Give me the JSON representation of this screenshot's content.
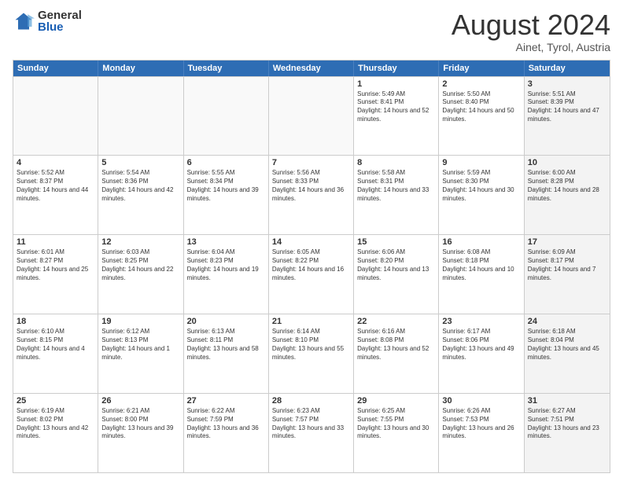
{
  "logo": {
    "general": "General",
    "blue": "Blue"
  },
  "title": "August 2024",
  "location": "Ainet, Tyrol, Austria",
  "days": [
    "Sunday",
    "Monday",
    "Tuesday",
    "Wednesday",
    "Thursday",
    "Friday",
    "Saturday"
  ],
  "weeks": [
    [
      {
        "day": "",
        "empty": true
      },
      {
        "day": "",
        "empty": true
      },
      {
        "day": "",
        "empty": true
      },
      {
        "day": "",
        "empty": true
      },
      {
        "day": "1",
        "sunrise": "5:49 AM",
        "sunset": "8:41 PM",
        "daylight": "14 hours and 52 minutes."
      },
      {
        "day": "2",
        "sunrise": "5:50 AM",
        "sunset": "8:40 PM",
        "daylight": "14 hours and 50 minutes."
      },
      {
        "day": "3",
        "sunrise": "5:51 AM",
        "sunset": "8:39 PM",
        "daylight": "14 hours and 47 minutes.",
        "shaded": true
      }
    ],
    [
      {
        "day": "4",
        "sunrise": "5:52 AM",
        "sunset": "8:37 PM",
        "daylight": "14 hours and 44 minutes."
      },
      {
        "day": "5",
        "sunrise": "5:54 AM",
        "sunset": "8:36 PM",
        "daylight": "14 hours and 42 minutes."
      },
      {
        "day": "6",
        "sunrise": "5:55 AM",
        "sunset": "8:34 PM",
        "daylight": "14 hours and 39 minutes."
      },
      {
        "day": "7",
        "sunrise": "5:56 AM",
        "sunset": "8:33 PM",
        "daylight": "14 hours and 36 minutes."
      },
      {
        "day": "8",
        "sunrise": "5:58 AM",
        "sunset": "8:31 PM",
        "daylight": "14 hours and 33 minutes."
      },
      {
        "day": "9",
        "sunrise": "5:59 AM",
        "sunset": "8:30 PM",
        "daylight": "14 hours and 30 minutes."
      },
      {
        "day": "10",
        "sunrise": "6:00 AM",
        "sunset": "8:28 PM",
        "daylight": "14 hours and 28 minutes.",
        "shaded": true
      }
    ],
    [
      {
        "day": "11",
        "sunrise": "6:01 AM",
        "sunset": "8:27 PM",
        "daylight": "14 hours and 25 minutes."
      },
      {
        "day": "12",
        "sunrise": "6:03 AM",
        "sunset": "8:25 PM",
        "daylight": "14 hours and 22 minutes."
      },
      {
        "day": "13",
        "sunrise": "6:04 AM",
        "sunset": "8:23 PM",
        "daylight": "14 hours and 19 minutes."
      },
      {
        "day": "14",
        "sunrise": "6:05 AM",
        "sunset": "8:22 PM",
        "daylight": "14 hours and 16 minutes."
      },
      {
        "day": "15",
        "sunrise": "6:06 AM",
        "sunset": "8:20 PM",
        "daylight": "14 hours and 13 minutes."
      },
      {
        "day": "16",
        "sunrise": "6:08 AM",
        "sunset": "8:18 PM",
        "daylight": "14 hours and 10 minutes."
      },
      {
        "day": "17",
        "sunrise": "6:09 AM",
        "sunset": "8:17 PM",
        "daylight": "14 hours and 7 minutes.",
        "shaded": true
      }
    ],
    [
      {
        "day": "18",
        "sunrise": "6:10 AM",
        "sunset": "8:15 PM",
        "daylight": "14 hours and 4 minutes."
      },
      {
        "day": "19",
        "sunrise": "6:12 AM",
        "sunset": "8:13 PM",
        "daylight": "14 hours and 1 minute."
      },
      {
        "day": "20",
        "sunrise": "6:13 AM",
        "sunset": "8:11 PM",
        "daylight": "13 hours and 58 minutes."
      },
      {
        "day": "21",
        "sunrise": "6:14 AM",
        "sunset": "8:10 PM",
        "daylight": "13 hours and 55 minutes."
      },
      {
        "day": "22",
        "sunrise": "6:16 AM",
        "sunset": "8:08 PM",
        "daylight": "13 hours and 52 minutes."
      },
      {
        "day": "23",
        "sunrise": "6:17 AM",
        "sunset": "8:06 PM",
        "daylight": "13 hours and 49 minutes."
      },
      {
        "day": "24",
        "sunrise": "6:18 AM",
        "sunset": "8:04 PM",
        "daylight": "13 hours and 45 minutes.",
        "shaded": true
      }
    ],
    [
      {
        "day": "25",
        "sunrise": "6:19 AM",
        "sunset": "8:02 PM",
        "daylight": "13 hours and 42 minutes."
      },
      {
        "day": "26",
        "sunrise": "6:21 AM",
        "sunset": "8:00 PM",
        "daylight": "13 hours and 39 minutes."
      },
      {
        "day": "27",
        "sunrise": "6:22 AM",
        "sunset": "7:59 PM",
        "daylight": "13 hours and 36 minutes."
      },
      {
        "day": "28",
        "sunrise": "6:23 AM",
        "sunset": "7:57 PM",
        "daylight": "13 hours and 33 minutes."
      },
      {
        "day": "29",
        "sunrise": "6:25 AM",
        "sunset": "7:55 PM",
        "daylight": "13 hours and 30 minutes."
      },
      {
        "day": "30",
        "sunrise": "6:26 AM",
        "sunset": "7:53 PM",
        "daylight": "13 hours and 26 minutes."
      },
      {
        "day": "31",
        "sunrise": "6:27 AM",
        "sunset": "7:51 PM",
        "daylight": "13 hours and 23 minutes.",
        "shaded": true
      }
    ]
  ]
}
